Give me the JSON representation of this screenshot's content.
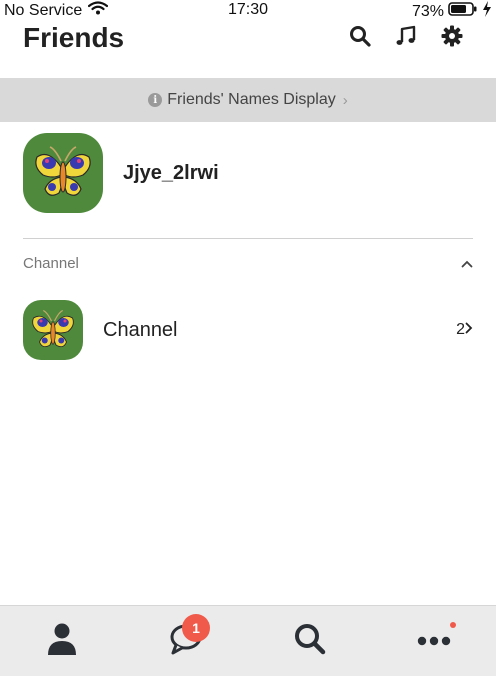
{
  "status_bar": {
    "carrier": "No Service",
    "time": "17:30",
    "battery": "73%"
  },
  "header": {
    "title": "Friends",
    "icons": [
      "search-icon",
      "music-icon",
      "gear-icon"
    ]
  },
  "notice": {
    "text": "Friends' Names Display"
  },
  "profile": {
    "name": "Jjye_2lrwi"
  },
  "section": {
    "label": "Channel"
  },
  "channel": {
    "name": "Channel",
    "count": "2"
  },
  "tabbar": {
    "tabs": [
      "friends-tab",
      "chats-tab",
      "search-tab",
      "more-tab"
    ],
    "chats_badge": "1"
  },
  "colors": {
    "avatar_bg": "#4f8a3c",
    "badge": "#f05a4a",
    "notice_bg": "#d9d9d9",
    "tabbar_bg": "#ebebeb"
  }
}
